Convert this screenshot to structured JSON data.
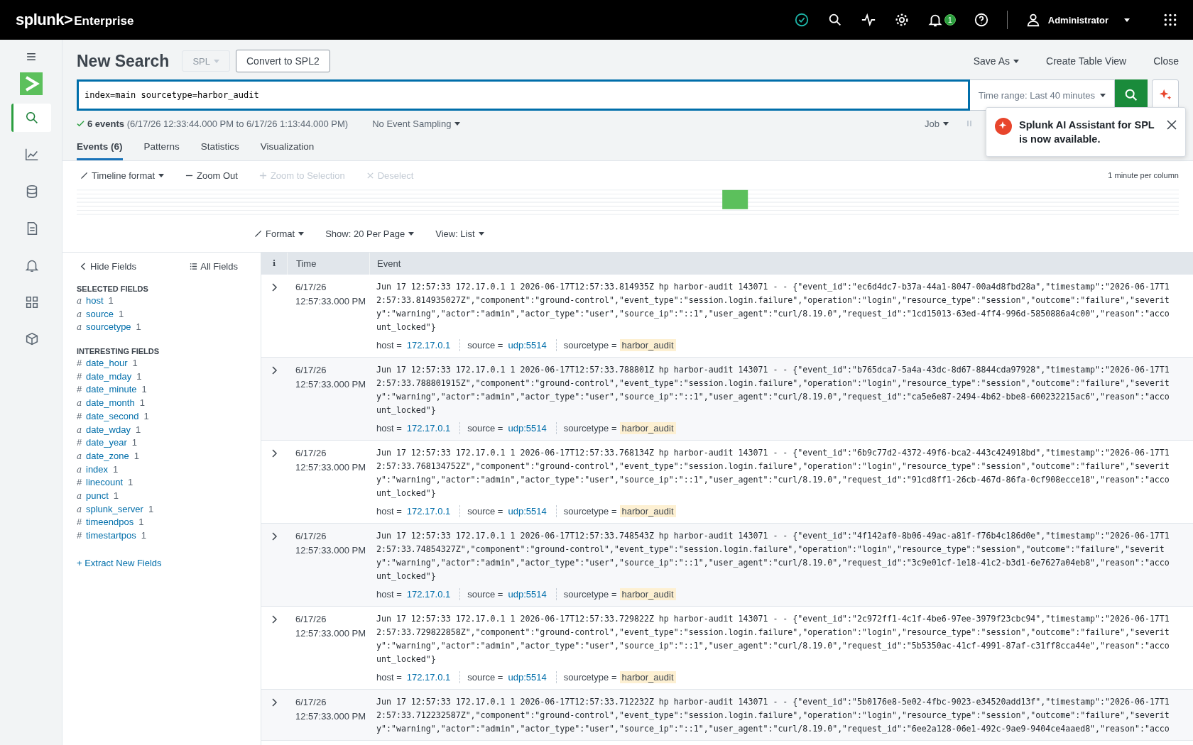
{
  "topbar": {
    "brand": "splunk>",
    "product": "Enterprise",
    "notification_count": "1",
    "user": "Administrator"
  },
  "nav": [
    {
      "selected": true
    },
    {
      "selected": false
    },
    {
      "selected": false
    },
    {
      "selected": false
    },
    {
      "selected": false
    },
    {
      "selected": false
    },
    {
      "selected": false
    }
  ],
  "header": {
    "title": "New Search",
    "language": {
      "label": "SPL",
      "disabled": true
    },
    "convert_button": "Convert to SPL2",
    "actions": [
      "Save As",
      "Create Table View",
      "Close"
    ]
  },
  "search": {
    "value": "index=main sourcetype=harbor_audit",
    "time_range": "Time range: Last 40 minutes"
  },
  "summary": {
    "text": "**6 events** (6/17/26 12:33:44.000 PM to 6/17/26 1:13:44.000 PM)",
    "sampling": "No Event Sampling",
    "job": "Job"
  },
  "toast": {
    "message": "Splunk AI Assistant for SPL is now available."
  },
  "tabs": [
    {
      "label": "Events (6)",
      "selected": true
    },
    {
      "label": "Patterns",
      "selected": false
    },
    {
      "label": "Statistics",
      "selected": false
    },
    {
      "label": "Visualization",
      "selected": false
    }
  ],
  "timeline": {
    "controls": [
      {
        "kind": "menu",
        "label": "Timeline format",
        "disabled": false
      },
      {
        "kind": "zoom-out",
        "label": "Zoom Out",
        "disabled": false
      },
      {
        "kind": "zoom-in",
        "label": "Zoom to Selection",
        "disabled": true
      },
      {
        "kind": "deselect",
        "label": "Deselect",
        "disabled": true
      }
    ],
    "scale": "1 minute per column"
  },
  "results_options": [
    "Format",
    "Show: 20 Per Page",
    "View: List"
  ],
  "fields_sidebar": {
    "hide": "Hide Fields",
    "all": "All Fields",
    "selected_heading": "SELECTED FIELDS",
    "selected": [
      {
        "type": "a",
        "name": "host",
        "count": "1"
      },
      {
        "type": "a",
        "name": "source",
        "count": "1"
      },
      {
        "type": "a",
        "name": "sourcetype",
        "count": "1"
      }
    ],
    "interesting_heading": "INTERESTING FIELDS",
    "interesting": [
      {
        "type": "#",
        "name": "date_hour",
        "count": "1"
      },
      {
        "type": "#",
        "name": "date_mday",
        "count": "1"
      },
      {
        "type": "#",
        "name": "date_minute",
        "count": "1"
      },
      {
        "type": "a",
        "name": "date_month",
        "count": "1"
      },
      {
        "type": "#",
        "name": "date_second",
        "count": "1"
      },
      {
        "type": "a",
        "name": "date_wday",
        "count": "1"
      },
      {
        "type": "#",
        "name": "date_year",
        "count": "1"
      },
      {
        "type": "a",
        "name": "date_zone",
        "count": "1"
      },
      {
        "type": "a",
        "name": "index",
        "count": "1"
      },
      {
        "type": "#",
        "name": "linecount",
        "count": "1"
      },
      {
        "type": "a",
        "name": "punct",
        "count": "1"
      },
      {
        "type": "a",
        "name": "splunk_server",
        "count": "1"
      },
      {
        "type": "#",
        "name": "timeendpos",
        "count": "1"
      },
      {
        "type": "#",
        "name": "timestartpos",
        "count": "1"
      }
    ],
    "extract": "+ Extract New Fields"
  },
  "table": {
    "columns": [
      "i",
      "Time",
      "Event"
    ],
    "rows": [
      {
        "date": "6/17/26",
        "time": "12:57:33.000 PM",
        "raw": "Jun 17 12:57:33 172.17.0.1 1 2026-06-17T12:57:33.814935Z hp harbor-audit 143071 - - {\"event_id\":\"ec6d4dc7-b37a-44a1-8047-00a4d8fbd28a\",\"timestamp\":\"2026-06-17T12:57:33.814935027Z\",\"component\":\"ground-control\",\"event_type\":\"session.login.failure\",\"operation\":\"login\",\"resource_type\":\"session\",\"outcome\":\"failure\",\"severity\":\"warning\",\"actor\":\"admin\",\"actor_type\":\"user\",\"source_ip\":\"::1\",\"user_agent\":\"curl/8.19.0\",\"request_id\":\"1cd15013-63ed-4ff4-996d-5850886a4c00\",\"reason\":\"account_locked\"}",
        "fields": [
          {
            "label": "host =",
            "value": "172.17.0.1",
            "highlighted": false
          },
          {
            "label": "source =",
            "value": "udp:5514",
            "highlighted": false
          },
          {
            "label": "sourcetype =",
            "value": "harbor_audit",
            "highlighted": true
          }
        ]
      },
      {
        "date": "6/17/26",
        "time": "12:57:33.000 PM",
        "raw": "Jun 17 12:57:33 172.17.0.1 1 2026-06-17T12:57:33.788801Z hp harbor-audit 143071 - - {\"event_id\":\"b765dca7-5a4a-43dc-8d67-8844cda97928\",\"timestamp\":\"2026-06-17T12:57:33.788801915Z\",\"component\":\"ground-control\",\"event_type\":\"session.login.failure\",\"operation\":\"login\",\"resource_type\":\"session\",\"outcome\":\"failure\",\"severity\":\"warning\",\"actor\":\"admin\",\"actor_type\":\"user\",\"source_ip\":\"::1\",\"user_agent\":\"curl/8.19.0\",\"request_id\":\"ca5e6e87-2494-4b62-bbe8-600232215ac6\",\"reason\":\"account_locked\"}",
        "fields": [
          {
            "label": "host =",
            "value": "172.17.0.1",
            "highlighted": false
          },
          {
            "label": "source =",
            "value": "udp:5514",
            "highlighted": false
          },
          {
            "label": "sourcetype =",
            "value": "harbor_audit",
            "highlighted": true
          }
        ]
      },
      {
        "date": "6/17/26",
        "time": "12:57:33.000 PM",
        "raw": "Jun 17 12:57:33 172.17.0.1 1 2026-06-17T12:57:33.768134Z hp harbor-audit 143071 - - {\"event_id\":\"6b9c77d2-4372-49f6-bca2-443c424918bd\",\"timestamp\":\"2026-06-17T12:57:33.768134752Z\",\"component\":\"ground-control\",\"event_type\":\"session.login.failure\",\"operation\":\"login\",\"resource_type\":\"session\",\"outcome\":\"failure\",\"severity\":\"warning\",\"actor\":\"admin\",\"actor_type\":\"user\",\"source_ip\":\"::1\",\"user_agent\":\"curl/8.19.0\",\"request_id\":\"91cd8ff1-26cb-467d-86fa-0cf908ecce18\",\"reason\":\"account_locked\"}",
        "fields": [
          {
            "label": "host =",
            "value": "172.17.0.1",
            "highlighted": false
          },
          {
            "label": "source =",
            "value": "udp:5514",
            "highlighted": false
          },
          {
            "label": "sourcetype =",
            "value": "harbor_audit",
            "highlighted": true
          }
        ]
      },
      {
        "date": "6/17/26",
        "time": "12:57:33.000 PM",
        "raw": "Jun 17 12:57:33 172.17.0.1 1 2026-06-17T12:57:33.748543Z hp harbor-audit 143071 - - {\"event_id\":\"4f142af0-8b06-49ac-a81f-f76b4c186d0e\",\"timestamp\":\"2026-06-17T12:57:33.74854327Z\",\"component\":\"ground-control\",\"event_type\":\"session.login.failure\",\"operation\":\"login\",\"resource_type\":\"session\",\"outcome\":\"failure\",\"severity\":\"warning\",\"actor\":\"admin\",\"actor_type\":\"user\",\"source_ip\":\"::1\",\"user_agent\":\"curl/8.19.0\",\"request_id\":\"3c9e01cf-1e18-41c2-b3d1-6e7627a04eb8\",\"reason\":\"account_locked\"}",
        "fields": [
          {
            "label": "host =",
            "value": "172.17.0.1",
            "highlighted": false
          },
          {
            "label": "source =",
            "value": "udp:5514",
            "highlighted": false
          },
          {
            "label": "sourcetype =",
            "value": "harbor_audit",
            "highlighted": true
          }
        ]
      },
      {
        "date": "6/17/26",
        "time": "12:57:33.000 PM",
        "raw": "Jun 17 12:57:33 172.17.0.1 1 2026-06-17T12:57:33.729822Z hp harbor-audit 143071 - - {\"event_id\":\"2c972ff1-4c1f-4be6-97ee-3979f23cbc94\",\"timestamp\":\"2026-06-17T12:57:33.729822858Z\",\"component\":\"ground-control\",\"event_type\":\"session.login.failure\",\"operation\":\"login\",\"resource_type\":\"session\",\"outcome\":\"failure\",\"severity\":\"warning\",\"actor\":\"admin\",\"actor_type\":\"user\",\"source_ip\":\"::1\",\"user_agent\":\"curl/8.19.0\",\"request_id\":\"5b5350ac-41cf-4991-87af-c31ff8cca44e\",\"reason\":\"account_locked\"}",
        "fields": [
          {
            "label": "host =",
            "value": "172.17.0.1",
            "highlighted": false
          },
          {
            "label": "source =",
            "value": "udp:5514",
            "highlighted": false
          },
          {
            "label": "sourcetype =",
            "value": "harbor_audit",
            "highlighted": true
          }
        ]
      },
      {
        "date": "6/17/26",
        "time": "12:57:33.000 PM",
        "raw": "Jun 17 12:57:33 172.17.0.1 1 2026-06-17T12:57:33.712232Z hp harbor-audit 143071 - - {\"event_id\":\"5b0176e8-5e02-4fbc-9023-e34520add13f\",\"timestamp\":\"2026-06-17T12:57:33.712232587Z\",\"component\":\"ground-control\",\"event_type\":\"session.login.failure\",\"operation\":\"login\",\"resource_type\":\"session\",\"outcome\":\"failure\",\"severity\":\"warning\",\"actor\":\"admin\",\"actor_type\":\"user\",\"source_ip\":\"::1\",\"user_agent\":\"curl/8.19.0\",\"request_id\":\"6ee2a128-06e1-492c-9ae9-9404ce4aaed8\",\"reason\":\"acco"
      }
    ]
  }
}
